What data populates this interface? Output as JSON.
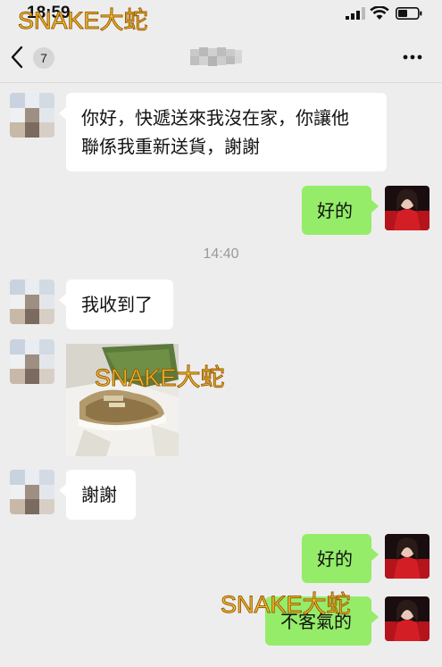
{
  "status_bar": {
    "time": "18:59",
    "icons": [
      "signal-icon",
      "wifi-icon",
      "battery-icon"
    ]
  },
  "nav": {
    "back_icon": "chevron-left-icon",
    "unread_count": "7",
    "more_icon": "more-dots-icon"
  },
  "watermark": {
    "text": "SNAKE大蛇",
    "color": "#f2c23a"
  },
  "messages": [
    {
      "side": "left",
      "type": "text",
      "text_line1": "你好，快遞送來我沒在家，你讓他",
      "text_line2": "聯係我重新送貨，謝謝"
    },
    {
      "side": "right",
      "type": "text",
      "text": "好的"
    },
    {
      "type": "timestamp",
      "text": "14:40"
    },
    {
      "side": "left",
      "type": "text",
      "text": "我收到了"
    },
    {
      "side": "left",
      "type": "image",
      "icon": "sneaker-photo"
    },
    {
      "side": "left",
      "type": "text",
      "text": "謝謝"
    },
    {
      "side": "right",
      "type": "text",
      "text": "好的"
    },
    {
      "side": "right",
      "type": "text",
      "text": "不客氣的"
    }
  ],
  "colors": {
    "background": "#ededed",
    "sent_bubble": "#95ec69",
    "received_bubble": "#ffffff"
  }
}
